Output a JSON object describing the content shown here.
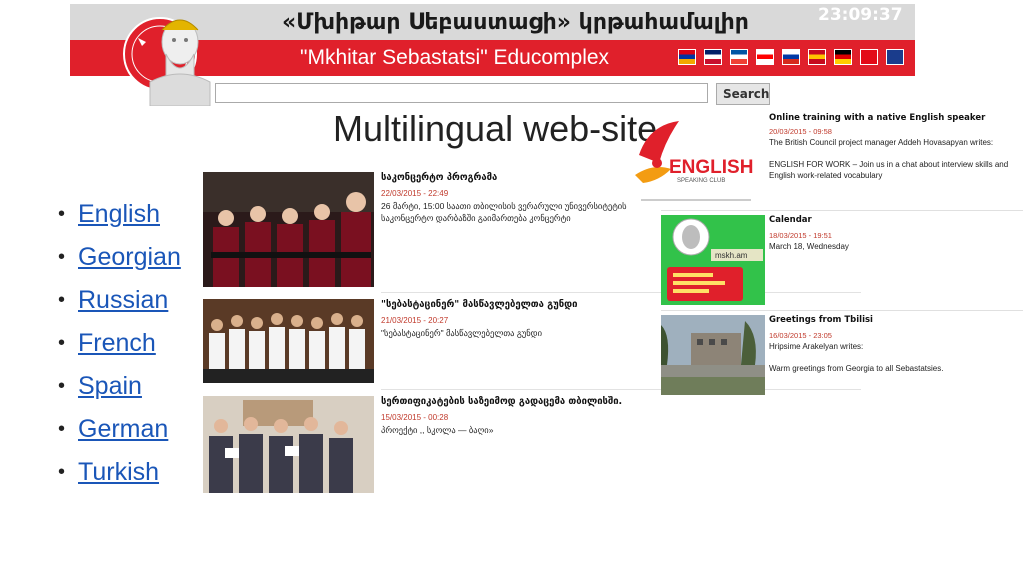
{
  "banner": {
    "title_armenian": "«Մխիթար Սեբաստացի» կրթահամալիր",
    "title_english": "\"Mkhitar Sebastatsi\" Educomplex",
    "clock": "23:09:37",
    "flags": [
      {
        "name": "armenian-flag-icon",
        "colors": [
          "#d90012",
          "#0033a0",
          "#f2a800"
        ]
      },
      {
        "name": "uk-flag-icon",
        "colors": [
          "#012169",
          "#ffffff",
          "#c8102e"
        ]
      },
      {
        "name": "french-flag-icon",
        "colors": [
          "#0055a4",
          "#ffffff",
          "#ef4135"
        ]
      },
      {
        "name": "georgian-flag-icon",
        "colors": [
          "#ffffff",
          "#ff0000",
          "#ffffff"
        ]
      },
      {
        "name": "russian-flag-icon",
        "colors": [
          "#ffffff",
          "#0039a6",
          "#d52b1e"
        ]
      },
      {
        "name": "spanish-flag-icon",
        "colors": [
          "#c60b1e",
          "#ffc400",
          "#c60b1e"
        ]
      },
      {
        "name": "german-flag-icon",
        "colors": [
          "#000000",
          "#dd0000",
          "#ffce00"
        ]
      },
      {
        "name": "turkish-flag-icon",
        "colors": [
          "#e30a17",
          "#e30a17",
          "#e30a17"
        ]
      },
      {
        "name": "armenian-letter-icon",
        "colors": [
          "#1a3c8c",
          "#1a3c8c",
          "#1a3c8c"
        ]
      }
    ]
  },
  "search": {
    "placeholder": "",
    "button_label": "Search"
  },
  "slide_title": "Multilingual web-site",
  "languages": [
    "English",
    "Georgian",
    "Russian",
    "French",
    "Spain",
    "German",
    "Turkish"
  ],
  "news": [
    {
      "title": "საკონცერტო პროგრამა",
      "date": "22/03/2015 - 22:49",
      "text": "26 მარტი, 15:00 საათი თბილისის ვერარული უნივერსიტეტის საკონცერტო დარბაზში გაიმართება კონცერტი"
    },
    {
      "title": "\"სებასტაცინერ\" მასწავლებელთა გუნდი",
      "date": "21/03/2015 - 20:27",
      "text": "\"სებასტაცინერ\" მასწავლებელთა გუნდი"
    },
    {
      "title": "სერთიფიკატების საზეიმოდ გადაცემა თბილისში.",
      "date": "15/03/2015 - 00:28",
      "text": "პროექტი ,, სკოლა — ბაღი»"
    }
  ],
  "sidebar": [
    {
      "title": "Online training with a native English speaker",
      "date": "20/03/2015 - 09:58",
      "text_1": "The British Council project manager Addeh Hovasapyan writes:",
      "text_2": "ENGLISH FOR WORK – Join us in a chat about interview skills and English work-related vocabulary",
      "logo_text": "ENGLISH",
      "logo_subtext": "SPEAKING CLUB"
    },
    {
      "title": "Calendar",
      "date": "18/03/2015 - 19:51",
      "text_1": "March 18, Wednesday",
      "badge": "mskh.am"
    },
    {
      "title": "Greetings from Tbilisi",
      "date": "16/03/2015 - 23:05",
      "text_1": "Hripsime Arakelyan writes:",
      "text_2": "Warm greetings from Georgia to all Sebastatsies."
    }
  ]
}
